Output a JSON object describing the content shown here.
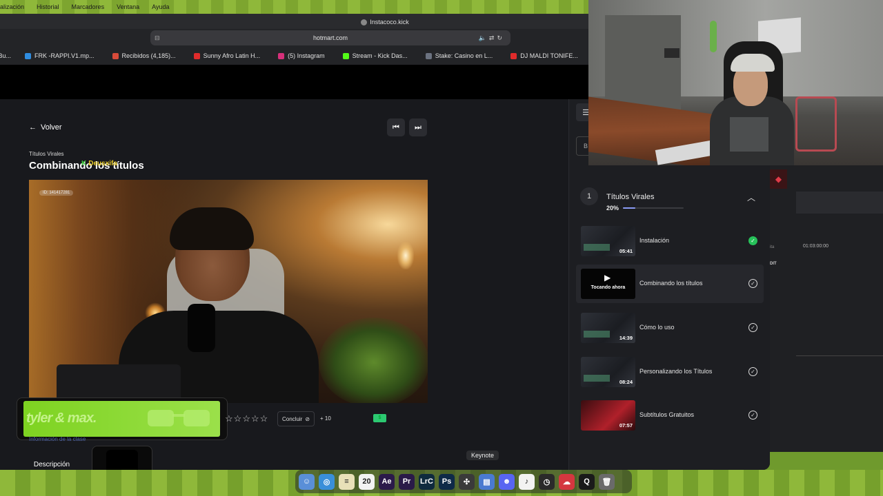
{
  "menubar": {
    "items": [
      "alización",
      "Historial",
      "Marcadores",
      "Ventana",
      "Ayuda"
    ]
  },
  "browser": {
    "tab_title": "Instacoco.kick",
    "url": "hotmart.com",
    "bookmarks": [
      {
        "label": "p Bu...",
        "color": "#3b6fd8"
      },
      {
        "label": "FRK -RAPPI.V1.mp...",
        "color": "#2f8de0"
      },
      {
        "label": "Recibidos (4,185)...",
        "color": "#d84b3a"
      },
      {
        "label": "Sunny Afro Latin H...",
        "color": "#e02b2b"
      },
      {
        "label": "(5) Instagram",
        "color": "#d6307a"
      },
      {
        "label": "Stream - Kick Das...",
        "color": "#53fc18"
      },
      {
        "label": "Stake: Casino en L...",
        "color": "#6b7280"
      },
      {
        "label": "DJ MALDI TONIFE...",
        "color": "#e02b2b"
      }
    ]
  },
  "page": {
    "back_label": "Volver",
    "breadcrumb": "Títulos Virales",
    "title": "Combinando los títulos",
    "sticker_text": "Deusxifa",
    "video_tag": "ID: 141417281",
    "concluir_label": "Concluir",
    "points": "+ 10",
    "money_label": "$",
    "info_link": "Información de la clase",
    "description_tab": "Descripción",
    "tm_banner_text": "tyler & max."
  },
  "sidebar": {
    "filter_label": "B",
    "module": {
      "number": "1",
      "title": "Títulos Virales",
      "progress_label": "20%",
      "progress": 0.2
    },
    "lessons": [
      {
        "name": "Instalación",
        "duration": "05:41",
        "status": "done",
        "thumb": "dark"
      },
      {
        "name": "Combinando los títulos",
        "duration": "",
        "status": "playing",
        "now_label": "Tocando ahora",
        "thumb": "playing"
      },
      {
        "name": "Cómo lo uso",
        "duration": "14:39",
        "status": "todo",
        "thumb": "dark"
      },
      {
        "name": "Personalizando los Títulos",
        "duration": "08:24",
        "status": "todo",
        "thumb": "dark"
      },
      {
        "name": "Subtítulos Gratuitos",
        "duration": "07:57",
        "status": "todo",
        "thumb": "red"
      }
    ]
  },
  "editor_overflow": {
    "timecode": "01:03:00:00",
    "edit_label": "DIT",
    "ta_label": "ita"
  },
  "dock": {
    "tooltip": "Keynote",
    "apps": [
      {
        "name": "finder",
        "label": "☺",
        "color": "#5a8fd8"
      },
      {
        "name": "safari",
        "label": "◎",
        "color": "#3a8fd9"
      },
      {
        "name": "notes",
        "label": "≡",
        "color": "#e8e0b8"
      },
      {
        "name": "calendar",
        "label": "20",
        "color": "#f2f2f2"
      },
      {
        "name": "after-effects",
        "label": "Ae",
        "color": "#2b1a4a"
      },
      {
        "name": "premiere",
        "label": "Pr",
        "color": "#2a1a48"
      },
      {
        "name": "lightroom-classic",
        "label": "LrC",
        "color": "#0f2a3e"
      },
      {
        "name": "photoshop",
        "label": "Ps",
        "color": "#0f2a48"
      },
      {
        "name": "davinci",
        "label": "✣",
        "color": "#3a3a3a"
      },
      {
        "name": "keynote",
        "label": "▤",
        "color": "#4a7ad0"
      },
      {
        "name": "discord",
        "label": "☻",
        "color": "#5865f2"
      },
      {
        "name": "music",
        "label": "♪",
        "color": "#f2f2f2"
      },
      {
        "name": "activity",
        "label": "◷",
        "color": "#2a2a2a"
      },
      {
        "name": "creative-cloud",
        "label": "☁",
        "color": "#d4373f"
      },
      {
        "name": "quicktime",
        "label": "Q",
        "color": "#1a1a1a"
      },
      {
        "name": "trash",
        "label": "🗑",
        "color": "#6a6a6a"
      }
    ]
  }
}
